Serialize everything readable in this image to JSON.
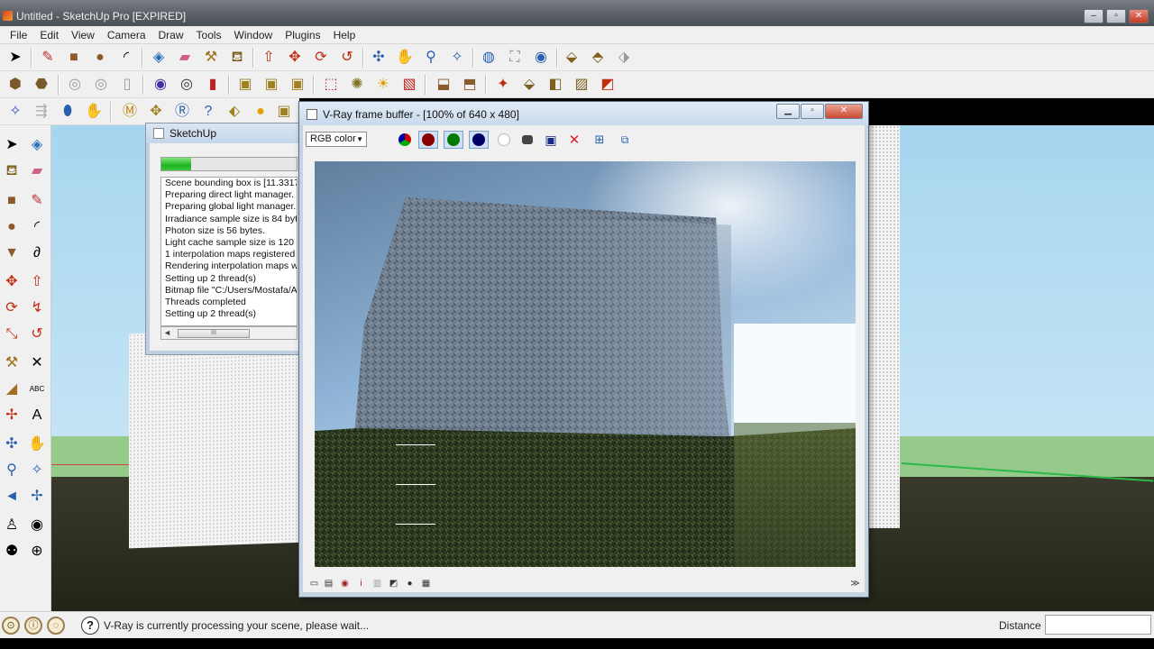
{
  "window": {
    "title": "Untitled - SketchUp Pro [EXPIRED]",
    "minimize": "–",
    "maximize": "▫",
    "close": "✕"
  },
  "menu": [
    "File",
    "Edit",
    "View",
    "Camera",
    "Draw",
    "Tools",
    "Window",
    "Plugins",
    "Help"
  ],
  "progress_dialog": {
    "title": "SketchUp",
    "progress": 0.22,
    "log_lines": [
      "Scene bounding box is [11.3317,",
      "Preparing direct light manager.",
      "Preparing global light manager.",
      "Irradiance sample size is 84 byte",
      "Photon size is 56 bytes.",
      "Light cache sample size is 120 by",
      "1 interpolation maps registered",
      "Rendering interpolation maps wit",
      "Setting up 2 thread(s)",
      "Bitmap file \"C:/Users/Mostafa/Ap",
      "Threads completed",
      "Setting up 2 thread(s)"
    ],
    "scroll_thumb": "III"
  },
  "vfb": {
    "title": "V-Ray frame buffer - [100% of 640 x 480]",
    "channel": "RGB color",
    "channel_arrow": "▼",
    "close": "✕",
    "minimize": "▁",
    "restore": "▫",
    "colors": {
      "red": "#8a0000",
      "green": "#007a00",
      "blue": "#000066"
    },
    "expand_arrow": "≫"
  },
  "statusbar": {
    "help": "?",
    "message": "V-Ray is currently processing your scene, please wait...",
    "vcb_label": "Distance",
    "vcb_value": ""
  }
}
